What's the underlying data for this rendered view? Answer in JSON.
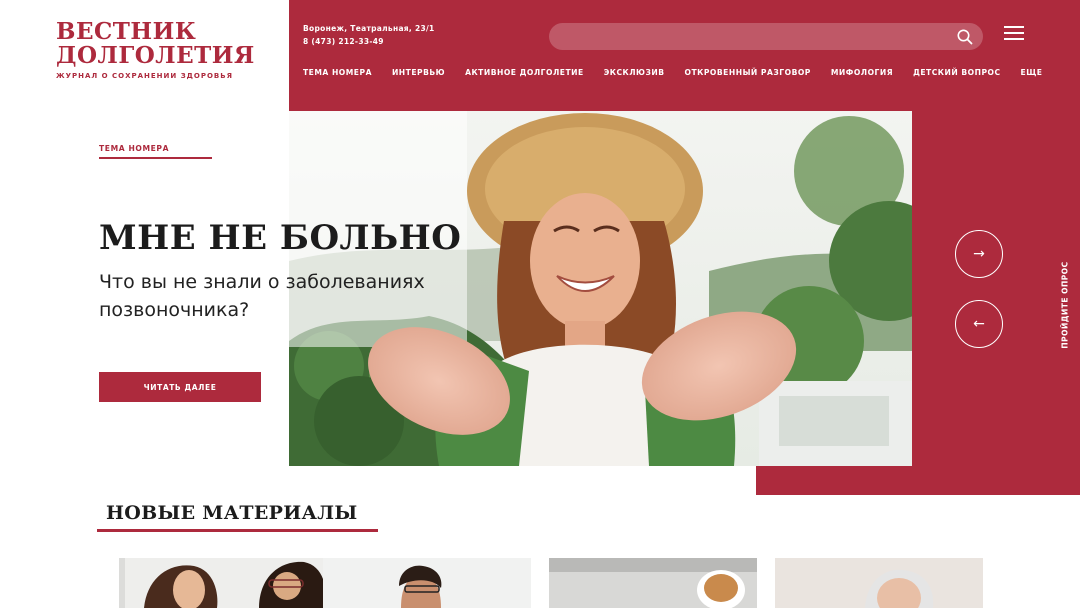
{
  "logo": {
    "line1": "ВЕСТНИК",
    "line2": "ДОЛГОЛЕТИЯ",
    "tagline": "ЖУРНАЛ О СОХРАНЕНИИ ЗДОРОВЬЯ"
  },
  "contacts": {
    "address": "Воронеж, Театральная, 23/1",
    "phone": "8 (473) 212-33-49"
  },
  "search": {
    "placeholder": "",
    "icon": "search-icon"
  },
  "menu_icon": "hamburger-icon",
  "nav": [
    "ТЕМА НОМЕРА",
    "ИНТЕРВЬЮ",
    "АКТИВНОЕ ДОЛГОЛЕТИЕ",
    "ЭКСКЛЮЗИВ",
    "ОТКРОВЕННЫЙ РАЗГОВОР",
    "МИФОЛОГИЯ",
    "ДЕТСКИЙ ВОПРОС",
    "ЕЩЕ"
  ],
  "hero": {
    "rubric": "ТЕМА НОМЕРА",
    "title": "МНЕ НЕ БОЛЬНО",
    "subtitle": "Что вы не знали о заболеваниях позвоночника?",
    "button": "ЧИТАТЬ ДАЛЕЕ",
    "next_arrow": "→",
    "prev_arrow": "←",
    "survey": "ПРОЙДИТЕ ОПРОС"
  },
  "new_materials": {
    "title": "НОВЫЕ МАТЕРИАЛЫ"
  },
  "colors": {
    "accent": "#ad2a3d",
    "text": "#1c1c1c",
    "background": "#ffffff"
  }
}
